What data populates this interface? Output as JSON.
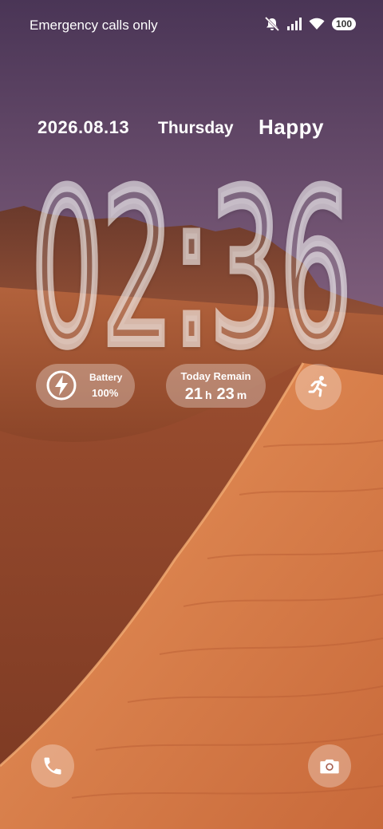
{
  "status_bar": {
    "carrier_text": "Emergency calls only",
    "battery_level": "100",
    "icons": [
      "mute-icon",
      "signal-icon",
      "wifi-icon",
      "battery-icon"
    ]
  },
  "lockscreen": {
    "date": "2026.08.13",
    "weekday": "Thursday",
    "greeting": "Happy",
    "time": "02:36",
    "widgets": {
      "battery": {
        "label": "Battery",
        "value": "100%"
      },
      "today_remain": {
        "label": "Today Remain",
        "hours": "21",
        "hours_unit": "h",
        "minutes": "23",
        "minutes_unit": "m"
      },
      "running_icon": "running-person-icon"
    },
    "shortcuts": [
      "phone-icon",
      "camera-icon"
    ]
  }
}
